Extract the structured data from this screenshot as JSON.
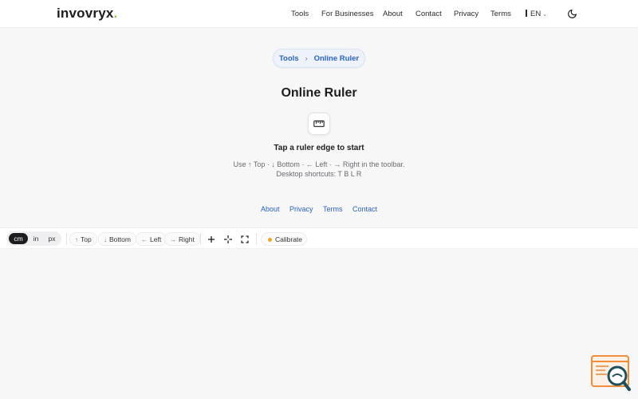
{
  "header": {
    "logo": {
      "text": "invovryx",
      "dot": "."
    },
    "nav": [
      {
        "label": "Tools"
      },
      {
        "label": "For Businesses"
      },
      {
        "label": "About"
      },
      {
        "label": "Contact"
      },
      {
        "label": "Privacy"
      },
      {
        "label": "Terms"
      }
    ],
    "language": "EN",
    "theme_icon": "moon-icon"
  },
  "breadcrumb": {
    "parent": "Tools",
    "separator": "›",
    "current": "Online Ruler"
  },
  "main": {
    "title": "Online Ruler",
    "tile_icon": "ruler-icon",
    "hint_title": "Tap a ruler edge to start",
    "hint_line1": "Use ↑ Top · ↓ Bottom · ← Left · → Right in the toolbar.",
    "hint_line2": "Desktop shortcuts: T B L R"
  },
  "footer": {
    "links": [
      "About",
      "Privacy",
      "Terms",
      "Contact"
    ]
  },
  "toolbar": {
    "units": [
      {
        "label": "cm",
        "active": true
      },
      {
        "label": "in",
        "active": false
      },
      {
        "label": "px",
        "active": false
      }
    ],
    "edges": [
      {
        "arrow": "↑",
        "label": "Top"
      },
      {
        "arrow": "↓",
        "label": "Bottom"
      },
      {
        "arrow": "←",
        "label": "Left"
      },
      {
        "arrow": "→",
        "label": "Right"
      }
    ],
    "icons": [
      "plus-icon",
      "crosshair-icon",
      "fullscreen-icon"
    ],
    "calibrate": "Calibrate"
  },
  "colors": {
    "accent": "#2862c2",
    "logo_dot": "#8cc43c",
    "calibrate_dot": "#f2a424",
    "widget_orange": "#f08c3c",
    "widget_teal": "#1e4f5a"
  },
  "widget_icon": "feedback-search-icon"
}
